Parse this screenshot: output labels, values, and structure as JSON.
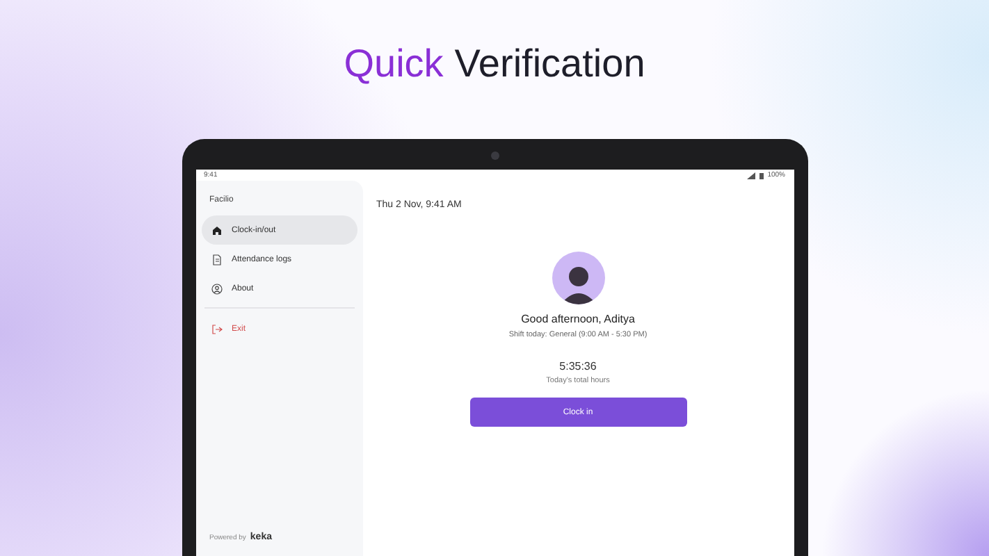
{
  "headline": [
    {
      "text": "Quick",
      "accent": true
    },
    {
      "text": "Verification",
      "accent": false
    }
  ],
  "status_bar": {
    "time": "9:41",
    "battery": "100%"
  },
  "sidebar": {
    "title": "Facilio",
    "items": [
      {
        "label": "Clock-in/out",
        "selected": true,
        "kind": "home"
      },
      {
        "label": "Attendance logs",
        "selected": false,
        "kind": "document"
      },
      {
        "label": "About",
        "selected": false,
        "kind": "person"
      }
    ],
    "exit": "Exit",
    "footer": {
      "prefix": "Powered by",
      "brand": "keka"
    }
  },
  "main": {
    "date": "Thu 2 Nov, 9:41 AM",
    "greeting": "Good afternoon, Aditya",
    "shift": "Shift today: General (9:00 AM - 5:30 PM)",
    "hours": "5:35:36",
    "hours_label": "Today's total hours",
    "button": "Clock in"
  }
}
